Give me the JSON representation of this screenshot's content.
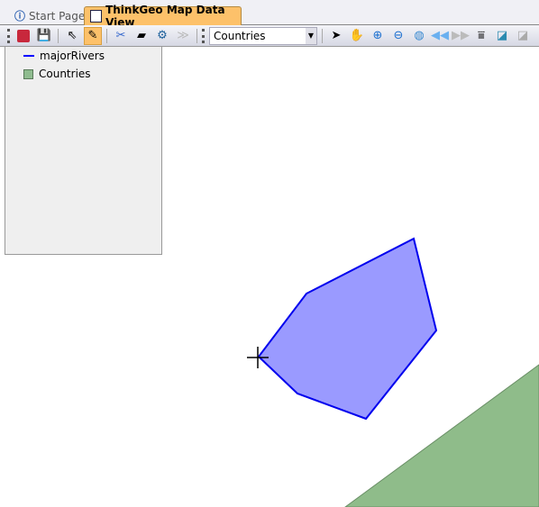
{
  "tabs": [
    {
      "label": "Start Page",
      "icon": "info-icon"
    },
    {
      "label": "ThinkGeo Map Data View",
      "icon": "map-icon",
      "active": true
    }
  ],
  "toolbar": {
    "selected_layer": "Countries",
    "tools": [
      "lock-icon",
      "save-icon",
      "select-icon",
      "edit-icon",
      "cut-icon",
      "eraser-icon",
      "merge-icon",
      "forward-icon",
      "pointer-icon",
      "pan-icon",
      "zoom-in-icon",
      "zoom-out-icon",
      "globe-icon",
      "back-icon",
      "next-icon",
      "measure-icon",
      "window-icon",
      "settings-icon"
    ]
  },
  "layers": [
    {
      "name": "majorRivers",
      "icon": "line-icon",
      "color": "#0000ff"
    },
    {
      "name": "Countries",
      "icon": "polygon-icon",
      "color": "#8fbc8f"
    }
  ],
  "colors": {
    "selected_feature_fill": "#9a9aff",
    "selected_feature_stroke": "#0000ee",
    "country_fill": "#8fbc8a"
  }
}
